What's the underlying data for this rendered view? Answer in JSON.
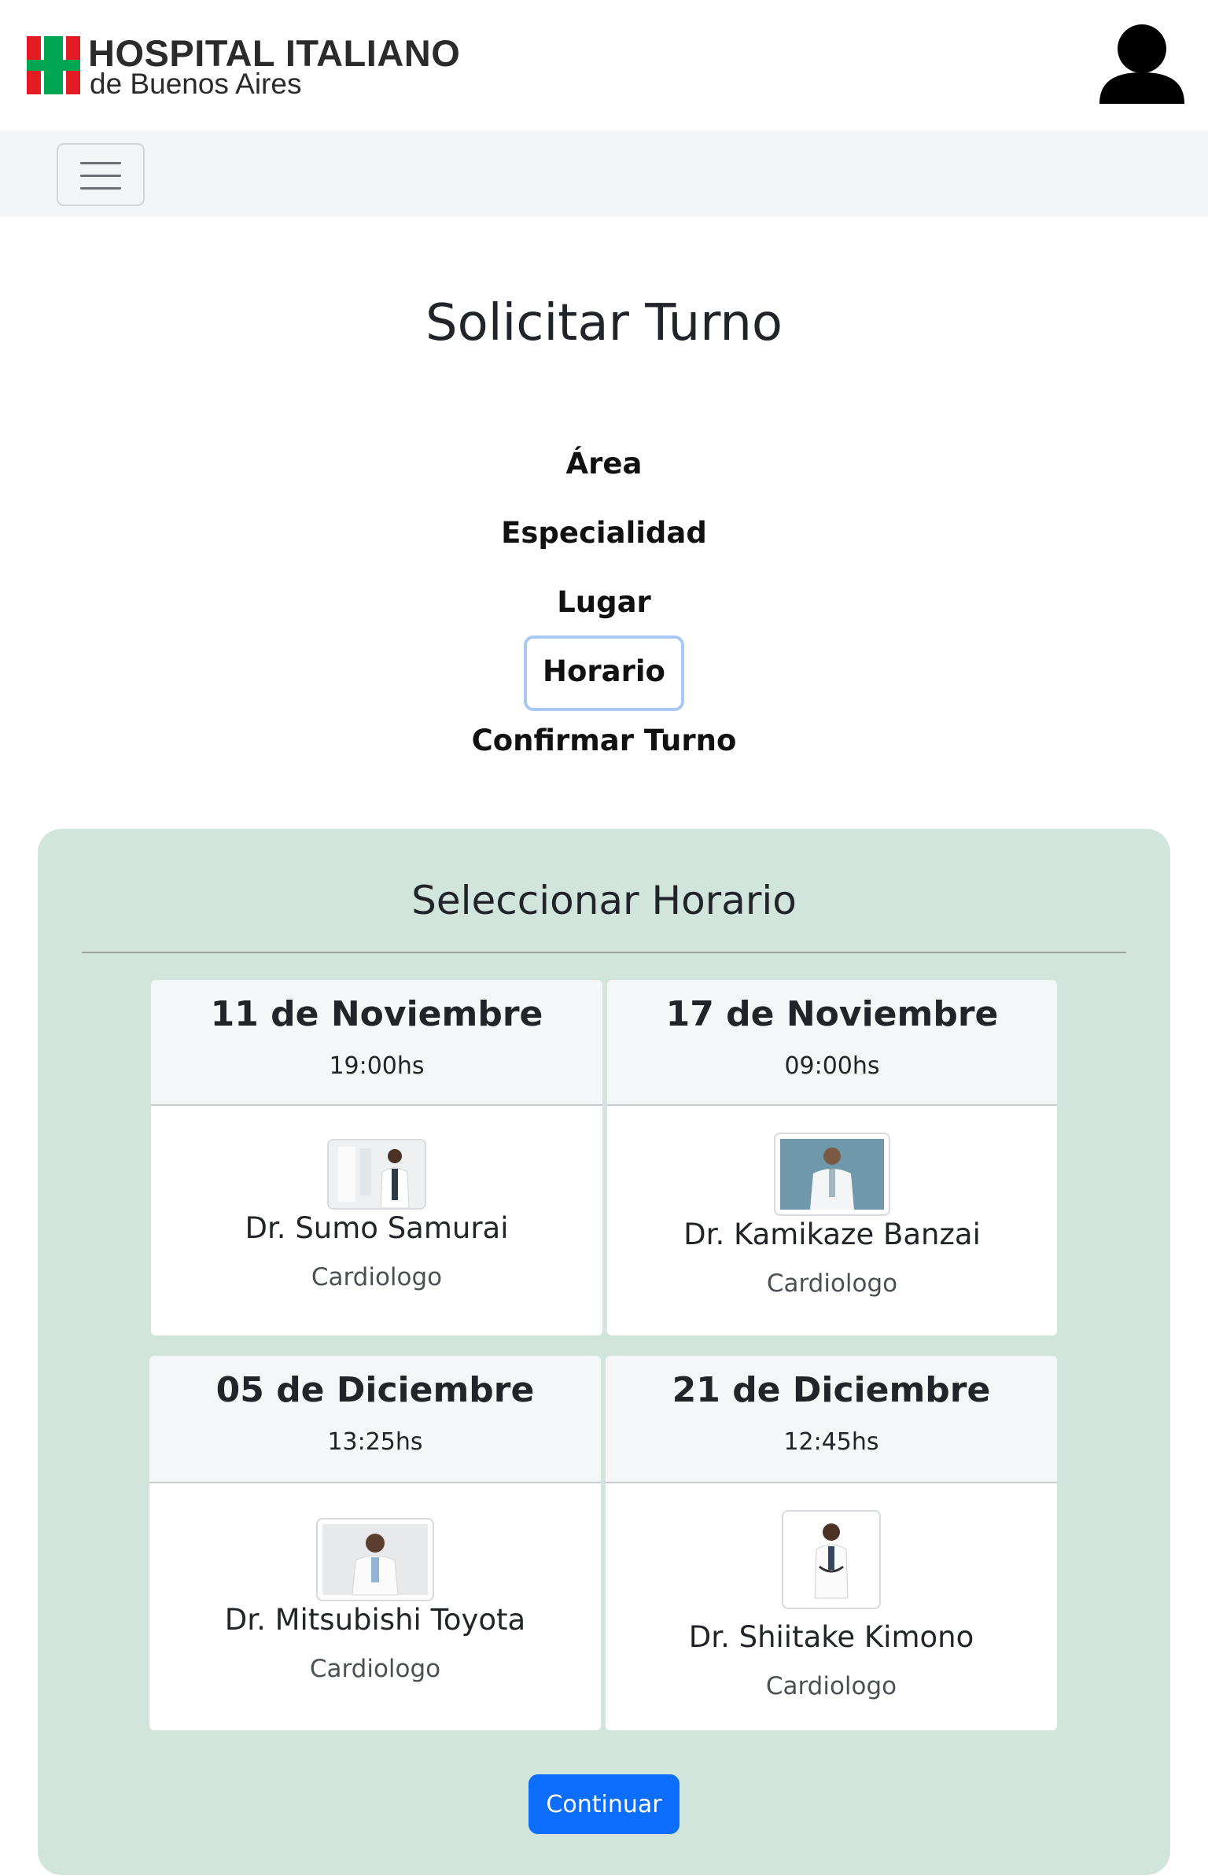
{
  "header": {
    "logo_title": "HOSPITAL ITALIANO",
    "logo_subtitle": "de Buenos Aires",
    "logo_icon": "hospital-cross-logo",
    "user_icon": "user-icon",
    "colors": {
      "cross_red": "#e31b23",
      "cross_green": "#00a651"
    }
  },
  "navbar": {
    "toggler_icon": "hamburger-menu-icon"
  },
  "page": {
    "title": "Solicitar Turno"
  },
  "steps": [
    {
      "label": "Área",
      "active": false
    },
    {
      "label": "Especialidad",
      "active": false
    },
    {
      "label": "Lugar",
      "active": false
    },
    {
      "label": "Horario",
      "active": true
    },
    {
      "label": "Confirmar Turno",
      "active": false
    }
  ],
  "panel": {
    "title": "Seleccionar Horario",
    "background": "#d1e5dc"
  },
  "slots": [
    {
      "date": "11 de Noviembre",
      "time": "19:00hs",
      "doctor": "Dr. Sumo Samurai",
      "specialty": "Cardiologo"
    },
    {
      "date": "17 de Noviembre",
      "time": "09:00hs",
      "doctor": "Dr. Kamikaze Banzai",
      "specialty": "Cardiologo"
    },
    {
      "date": "05 de Diciembre",
      "time": "13:25hs",
      "doctor": "Dr. Mitsubishi Toyota",
      "specialty": "Cardiologo"
    },
    {
      "date": "21 de Diciembre",
      "time": "12:45hs",
      "doctor": "Dr. Shiitake Kimono",
      "specialty": "Cardiologo"
    }
  ],
  "actions": {
    "continue_label": "Continuar",
    "accent": "#0d6efd"
  }
}
